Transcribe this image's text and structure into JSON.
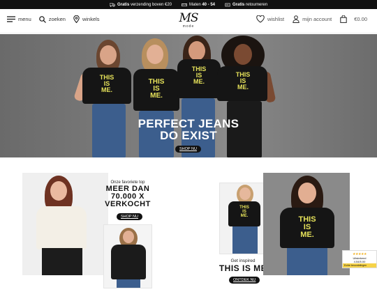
{
  "promo": {
    "items": [
      {
        "bold": "Gratis",
        "text": " verzending boven €20",
        "icon": "truck-icon"
      },
      {
        "text": "Maten ",
        "bold": "40 - 54",
        "icon": "ruler-icon"
      },
      {
        "bold": "Gratis",
        "text": " retourneren",
        "icon": "return-icon"
      }
    ]
  },
  "header": {
    "menu_label": "menu",
    "search_label": "zoeken",
    "stores_label": "winkels",
    "logo_main": "MS",
    "logo_sub": "mode",
    "wishlist_label": "wishlist",
    "account_label": "mijn account",
    "cart_total": "€0.00"
  },
  "hero": {
    "shirt_text": "THIS IS ME.",
    "shirt_line1": "THIS",
    "shirt_line2": "IS",
    "shirt_line3": "ME.",
    "title_line1": "PERFECT JEANS",
    "title_line2": "DO EXIST",
    "button_label": "SHOP NU",
    "shirt_color": "#151515",
    "print_color": "#e6e25a",
    "jeans_color": "#3c5e8d"
  },
  "favorites": {
    "subtitle": "Onze favoriete top",
    "title_line1": "MEER DAN",
    "title_line2": "70.000 X",
    "title_line3": "VERKOCHT",
    "button_label": "SHOP NU"
  },
  "inspired": {
    "subtitle": "Get inspired",
    "title": "THIS IS ME",
    "button_label": "ONTDEK NU"
  },
  "review_badge": {
    "stars": "★★★★★",
    "rating_text": "Uitstekend",
    "score": "4.54/5.00",
    "footer": "Echte beoordelingen"
  }
}
